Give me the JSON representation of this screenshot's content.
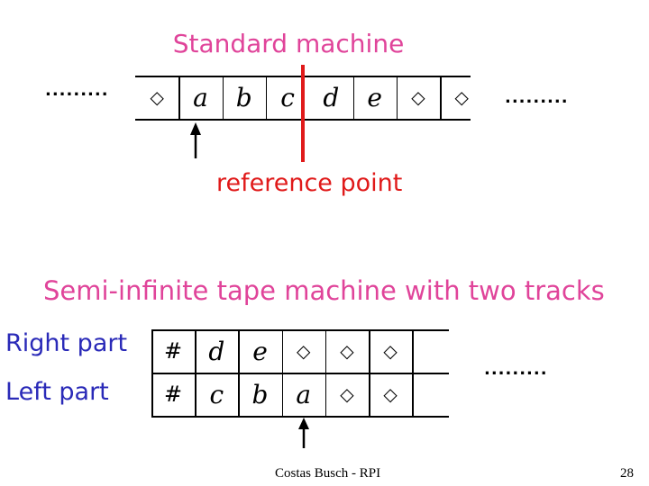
{
  "standard_machine": {
    "title": "Standard machine",
    "left_ellipsis": ".........",
    "right_ellipsis": ".........",
    "tape": [
      "◇",
      "a",
      "b",
      "c",
      "d",
      "e",
      "◇",
      "◇"
    ],
    "head_cell_index": 1,
    "reference_label": "reference point",
    "reference_after_cell_index": 3
  },
  "semi_infinite_machine": {
    "title": "Semi-infinite tape machine with two tracks",
    "tracks": [
      {
        "label": "Right part",
        "cells": [
          "#",
          "d",
          "e",
          "◇",
          "◇",
          "◇",
          ""
        ]
      },
      {
        "label": "Left part",
        "cells": [
          "#",
          "c",
          "b",
          "a",
          "◇",
          "◇",
          ""
        ]
      }
    ],
    "ellipsis": ".........",
    "head_cell_index": 3
  },
  "footer": {
    "author": "Costas Busch - RPI",
    "page_number": "28"
  },
  "colors": {
    "title": "#e0449a",
    "reference": "#e01a1a",
    "track_label": "#2a2ab8"
  }
}
